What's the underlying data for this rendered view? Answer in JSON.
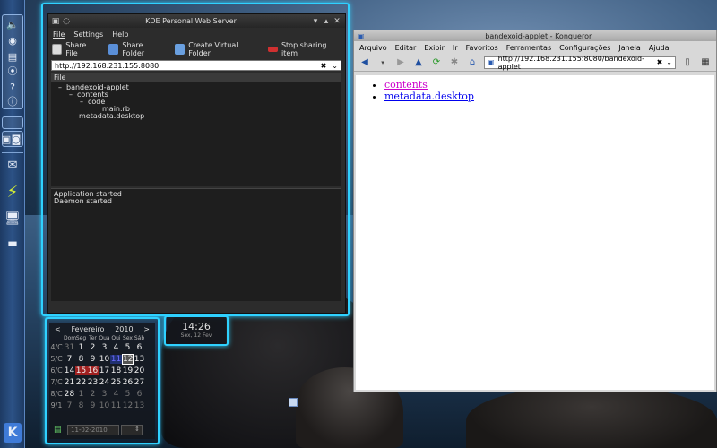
{
  "panel": {
    "icons": [
      "speaker-icon",
      "globe-icon",
      "clipboard-icon",
      "network-icon",
      "help-icon",
      "info-icon"
    ],
    "tasks": [
      "task-a-icon",
      "task-b-icon"
    ],
    "apps": [
      "mail-icon",
      "power-icon",
      "monitor-icon",
      "desktop-icon"
    ],
    "kde_label": "K"
  },
  "server_window": {
    "title": "KDE Personal Web Server",
    "menu": [
      "File",
      "Settings",
      "Help"
    ],
    "toolbar": {
      "share_file": "Share File",
      "share_folder": "Share Folder",
      "create_virtual_folder": "Create Virtual Folder",
      "stop_sharing": "Stop sharing item"
    },
    "url": "http://192.168.231.155:8080",
    "file_header": "File",
    "tree": [
      {
        "label": "bandexoid-applet",
        "prefix": "–",
        "indent": 8
      },
      {
        "label": "contents",
        "prefix": "–",
        "indent": 20
      },
      {
        "label": "code",
        "prefix": "–",
        "indent": 32
      },
      {
        "label": "main.rb",
        "prefix": "",
        "indent": 52
      },
      {
        "label": "metadata.desktop",
        "prefix": "",
        "indent": 26
      }
    ],
    "log": [
      "Application started",
      "Daemon started"
    ]
  },
  "browser_window": {
    "title": "bandexoid-applet - Konqueror",
    "menu": [
      "Arquivo",
      "Editar",
      "Exibir",
      "Ir",
      "Favoritos",
      "Ferramentas",
      "Configurações",
      "Janela",
      "Ajuda"
    ],
    "url": "http://192.168.231.155:8080/bandexoid-applet",
    "links": [
      {
        "text": "contents",
        "visited": true
      },
      {
        "text": "metadata.desktop",
        "visited": false
      }
    ]
  },
  "calendar": {
    "prev": "<",
    "month": "Fevereiro",
    "year": "2010",
    "next": ">",
    "weekdays": [
      "Dom",
      "Seg",
      "Ter",
      "Qua",
      "Qui",
      "Sex",
      "Sáb"
    ],
    "weeks": [
      {
        "week": "4/C",
        "days": [
          "31",
          "1",
          "2",
          "3",
          "4",
          "5",
          "6"
        ]
      },
      {
        "week": "5/C",
        "days": [
          "7",
          "8",
          "9",
          "10",
          "11",
          "12",
          "13"
        ]
      },
      {
        "week": "6/C",
        "days": [
          "14",
          "15",
          "16",
          "17",
          "18",
          "19",
          "20"
        ]
      },
      {
        "week": "7/C",
        "days": [
          "21",
          "22",
          "23",
          "24",
          "25",
          "26",
          "27"
        ]
      },
      {
        "week": "8/C",
        "days": [
          "28",
          "1",
          "2",
          "3",
          "4",
          "5",
          "6"
        ]
      },
      {
        "week": "9/1",
        "days": [
          "7",
          "8",
          "9",
          "10",
          "11",
          "12",
          "13"
        ]
      }
    ],
    "today": "12",
    "date_value": "11-02-2010"
  },
  "clock": {
    "time": "14:26",
    "date": "Sex, 12 Fev"
  },
  "colors": {
    "glow": "#2fd1ff",
    "panel": "#2c5286",
    "visited_link": "#cc00cc",
    "link": "#0000ee"
  }
}
